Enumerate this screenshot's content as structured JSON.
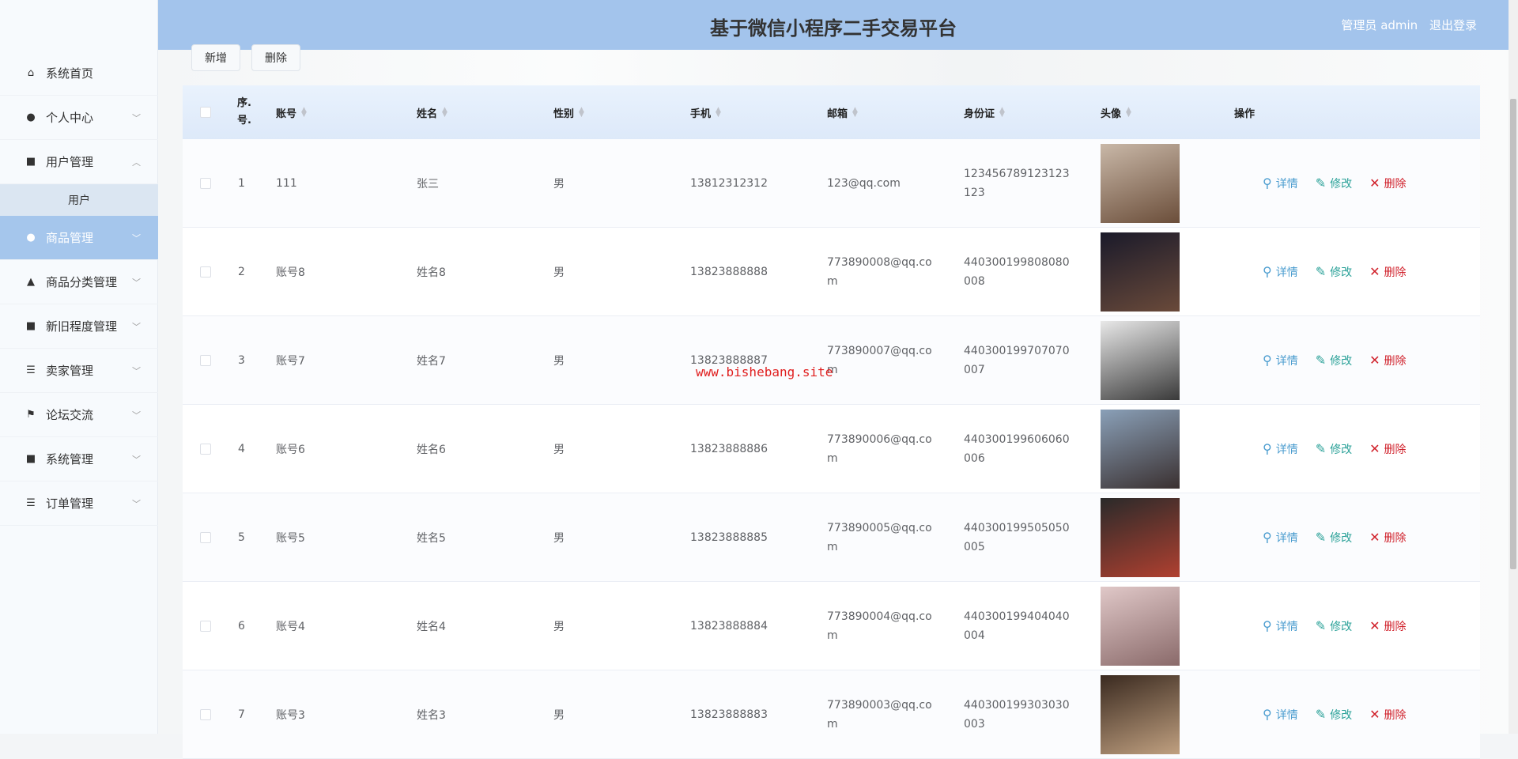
{
  "header": {
    "title": "基于微信小程序二手交易平台",
    "user_label": "管理员 admin",
    "logout": "退出登录"
  },
  "sidebar": {
    "items": [
      {
        "label": "系统首页",
        "icon": "home-icon",
        "chev": ""
      },
      {
        "label": "个人中心",
        "icon": "user-icon",
        "chev": "﹀"
      },
      {
        "label": "用户管理",
        "icon": "grid-icon",
        "chev": "︿"
      },
      {
        "label": "商品管理",
        "icon": "user-icon",
        "chev": "﹀"
      },
      {
        "label": "商品分类管理",
        "icon": "chart-icon",
        "chev": "﹀"
      },
      {
        "label": "新旧程度管理",
        "icon": "grid-icon",
        "chev": "﹀"
      },
      {
        "label": "卖家管理",
        "icon": "list-icon",
        "chev": "﹀"
      },
      {
        "label": "论坛交流",
        "icon": "flag-icon",
        "chev": "﹀"
      },
      {
        "label": "系统管理",
        "icon": "grid-icon",
        "chev": "﹀"
      },
      {
        "label": "订单管理",
        "icon": "list-icon",
        "chev": "﹀"
      }
    ],
    "sub_item": "用户"
  },
  "toolbar": {
    "add": "新增",
    "delete": "删除"
  },
  "table": {
    "headers": [
      "序.号.",
      "账号",
      "姓名",
      "性别",
      "手机",
      "邮箱",
      "身份证",
      "头像",
      "操作"
    ],
    "actions": {
      "detail": "详情",
      "edit": "修改",
      "delete": "删除"
    },
    "rows": [
      {
        "no": "1",
        "account": "111",
        "name": "张三",
        "gender": "男",
        "phone": "13812312312",
        "email": "123@qq.com",
        "idcard": "123456789123123123"
      },
      {
        "no": "2",
        "account": "账号8",
        "name": "姓名8",
        "gender": "男",
        "phone": "13823888888",
        "email": "773890008@qq.com",
        "idcard": "440300199808080008"
      },
      {
        "no": "3",
        "account": "账号7",
        "name": "姓名7",
        "gender": "男",
        "phone": "13823888887",
        "email": "773890007@qq.com",
        "idcard": "440300199707070007"
      },
      {
        "no": "4",
        "account": "账号6",
        "name": "姓名6",
        "gender": "男",
        "phone": "13823888886",
        "email": "773890006@qq.com",
        "idcard": "440300199606060006"
      },
      {
        "no": "5",
        "account": "账号5",
        "name": "姓名5",
        "gender": "男",
        "phone": "13823888885",
        "email": "773890005@qq.com",
        "idcard": "440300199505050005"
      },
      {
        "no": "6",
        "account": "账号4",
        "name": "姓名4",
        "gender": "男",
        "phone": "13823888884",
        "email": "773890004@qq.com",
        "idcard": "440300199404040004"
      },
      {
        "no": "7",
        "account": "账号3",
        "name": "姓名3",
        "gender": "男",
        "phone": "13823888883",
        "email": "773890003@qq.com",
        "idcard": "440300199303030003"
      }
    ]
  },
  "watermark": "www.bishebang.site"
}
